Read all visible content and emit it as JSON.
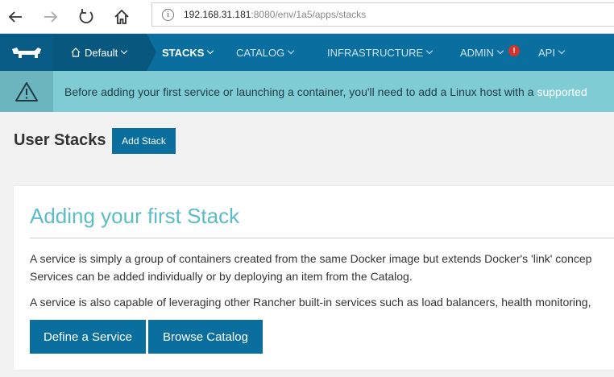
{
  "browser": {
    "url_host": "192.168.31.181",
    "url_rest": ":8080/env/1a5/apps/stacks"
  },
  "header": {
    "environment": "Default",
    "nav": [
      {
        "label": "STACKS",
        "active": true
      },
      {
        "label": "CATALOG"
      },
      {
        "label": "INFRASTRUCTURE"
      },
      {
        "label": "ADMIN"
      },
      {
        "label": "API"
      }
    ],
    "admin_badge": "!"
  },
  "banner": {
    "text": "Before adding your first service or launching a container, you'll need to add a Linux host with a",
    "link": "supported"
  },
  "page": {
    "title": "User Stacks",
    "add_button": "Add Stack"
  },
  "card": {
    "title": "Adding your first Stack",
    "line1": "A service is simply a group of containers created from the same Docker image but extends Docker's 'link' concep",
    "line2": "Services can be added individually or by deploying an item from the Catalog.",
    "line3": "A service is also capable of leveraging other Rancher built-in services such as load balancers, health monitoring, ",
    "btn_define": "Define a Service",
    "btn_browse": "Browse Catalog"
  },
  "colors": {
    "header": "#0a6e9e",
    "banner": "#7fccd4",
    "accent_title": "#5bbcc8",
    "badge": "#d0342c"
  }
}
